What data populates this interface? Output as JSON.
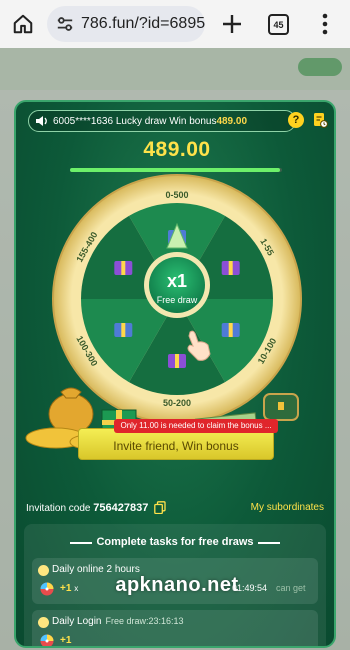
{
  "browser": {
    "url": "786.fun/?id=6895",
    "tab_count": "45",
    "icons": [
      "home-icon",
      "tune-icon",
      "plus-icon",
      "tabs-icon",
      "kebab-menu-icon"
    ]
  },
  "modal": {
    "ticker": {
      "text": "6005****1636 Lucky draw Win bonus",
      "amount": "489.00"
    },
    "help_label": "?",
    "balance": "489.00",
    "progress_fraction": 0.99,
    "wheel": {
      "segments": [
        "0-500",
        "1-55",
        "10-100",
        "50-200",
        "100-300",
        "155-400"
      ],
      "center_multiplier": "x1",
      "center_label": "Free draw"
    },
    "notice": "Only 11.00 is needed to claim the bonus ...",
    "invite_button": "Invite friend, Win bonus",
    "invitation_code_label": "Invitation code",
    "invitation_code": "756427837",
    "subordinates_link": "My subordinates",
    "tasks_title": "Complete tasks for free draws",
    "tasks": [
      {
        "name": "Daily online 2 hours",
        "sub": "",
        "reward": "+1",
        "reward_x": "x",
        "time": "01:49:54",
        "status": "can get"
      },
      {
        "name": "Daily Login",
        "sub": "Free draw:23:16:13",
        "reward": "+1",
        "reward_x": "",
        "time": "",
        "status": ""
      }
    ],
    "watermark": "apknano.net"
  },
  "colors": {
    "modal_green": "#0d5a39",
    "accent_yellow": "#ffe24a",
    "notice_red": "#e0262b"
  }
}
